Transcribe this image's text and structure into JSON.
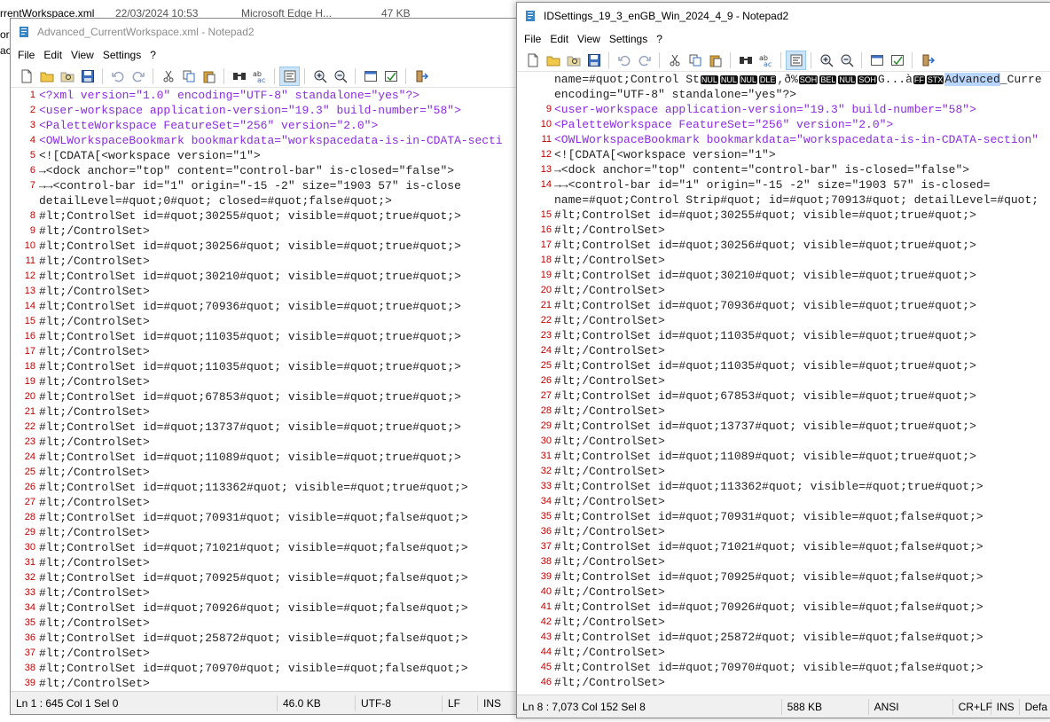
{
  "background": {
    "row_file": "rrentWorkspace.xml",
    "row_date": "22/03/2024 10:53",
    "row_type": "Microsoft Edge H...",
    "row_size": "47 KB",
    "side_text": [
      "ork",
      "ac"
    ]
  },
  "left_window": {
    "title": "Advanced_CurrentWorkspace.xml - Notepad2",
    "menu": [
      "File",
      "Edit",
      "View",
      "Settings",
      "?"
    ],
    "lines": [
      {
        "n": "1",
        "t": "<?xml version=\"1.0\" encoding=\"UTF-8\" standalone=\"yes\"?>"
      },
      {
        "n": "2",
        "t": "<user-workspace application-version=\"19.3\" build-number=\"58\">"
      },
      {
        "n": "3",
        "t": "<PaletteWorkspace FeatureSet=\"256\" version=\"2.0\">"
      },
      {
        "n": "4",
        "t": "<OWLWorkspaceBookmark bookmarkdata=\"workspacedata-is-in-CDATA-secti"
      },
      {
        "n": "5",
        "t": "<![CDATA[<workspace version=\"1\">"
      },
      {
        "n": "6",
        "t": "→<dock anchor=\"top\" content=\"control-bar\" is-closed=\"false\">"
      },
      {
        "n": "7",
        "t": "→→<control-bar id=\"1\" origin=\"-15 -2\" size=\"1903 57\" is-close"
      },
      {
        "n": "",
        "t": "detailLevel=#quot;0#quot; closed=#quot;false#quot;>"
      },
      {
        "n": "8",
        "t": "#lt;ControlSet id=#quot;30255#quot; visible=#quot;true#quot;>"
      },
      {
        "n": "9",
        "t": "#lt;/ControlSet>"
      },
      {
        "n": "10",
        "t": "#lt;ControlSet id=#quot;30256#quot; visible=#quot;true#quot;>"
      },
      {
        "n": "11",
        "t": "#lt;/ControlSet>"
      },
      {
        "n": "12",
        "t": "#lt;ControlSet id=#quot;30210#quot; visible=#quot;true#quot;>"
      },
      {
        "n": "13",
        "t": "#lt;/ControlSet>"
      },
      {
        "n": "14",
        "t": "#lt;ControlSet id=#quot;70936#quot; visible=#quot;true#quot;>"
      },
      {
        "n": "15",
        "t": "#lt;/ControlSet>"
      },
      {
        "n": "16",
        "t": "#lt;ControlSet id=#quot;11035#quot; visible=#quot;true#quot;>"
      },
      {
        "n": "17",
        "t": "#lt;/ControlSet>"
      },
      {
        "n": "18",
        "t": "#lt;ControlSet id=#quot;11035#quot; visible=#quot;true#quot;>"
      },
      {
        "n": "19",
        "t": "#lt;/ControlSet>"
      },
      {
        "n": "20",
        "t": "#lt;ControlSet id=#quot;67853#quot; visible=#quot;true#quot;>"
      },
      {
        "n": "21",
        "t": "#lt;/ControlSet>"
      },
      {
        "n": "22",
        "t": "#lt;ControlSet id=#quot;13737#quot; visible=#quot;true#quot;>"
      },
      {
        "n": "23",
        "t": "#lt;/ControlSet>"
      },
      {
        "n": "24",
        "t": "#lt;ControlSet id=#quot;11089#quot; visible=#quot;true#quot;>"
      },
      {
        "n": "25",
        "t": "#lt;/ControlSet>"
      },
      {
        "n": "26",
        "t": "#lt;ControlSet id=#quot;113362#quot; visible=#quot;true#quot;>"
      },
      {
        "n": "27",
        "t": "#lt;/ControlSet>"
      },
      {
        "n": "28",
        "t": "#lt;ControlSet id=#quot;70931#quot; visible=#quot;false#quot;>"
      },
      {
        "n": "29",
        "t": "#lt;/ControlSet>"
      },
      {
        "n": "30",
        "t": "#lt;ControlSet id=#quot;71021#quot; visible=#quot;false#quot;>"
      },
      {
        "n": "31",
        "t": "#lt;/ControlSet>"
      },
      {
        "n": "32",
        "t": "#lt;ControlSet id=#quot;70925#quot; visible=#quot;false#quot;>"
      },
      {
        "n": "33",
        "t": "#lt;/ControlSet>"
      },
      {
        "n": "34",
        "t": "#lt;ControlSet id=#quot;70926#quot; visible=#quot;false#quot;>"
      },
      {
        "n": "35",
        "t": "#lt;/ControlSet>"
      },
      {
        "n": "36",
        "t": "#lt;ControlSet id=#quot;25872#quot; visible=#quot;false#quot;>"
      },
      {
        "n": "37",
        "t": "#lt;/ControlSet>"
      },
      {
        "n": "38",
        "t": "#lt;ControlSet id=#quot;70970#quot; visible=#quot;false#quot;>"
      },
      {
        "n": "39",
        "t": "#lt;/ControlSet>"
      }
    ],
    "status": {
      "position": "Ln 1 : 645  Col 1  Sel 0",
      "size": "46.0 KB",
      "encoding": "UTF-8",
      "eol": "LF",
      "mode": "INS"
    }
  },
  "right_window": {
    "title": "IDSettings_19_3_enGB_Win_2024_4_9 - Notepad2",
    "menu": [
      "File",
      "Edit",
      "View",
      "Settings",
      "?"
    ],
    "first_line": {
      "pre": "name=#quot;Control St",
      "ctl1": [
        "NUL",
        "NUL",
        "NUL",
        "DLE"
      ],
      "mid1": ",ð%",
      "ctl2": [
        "SOH",
        "BEL",
        "NUL",
        "SOH"
      ],
      "mid2": "G...à",
      "ctl3": [
        "FF",
        "STX"
      ],
      "sel": "Advanced",
      "post": "_Curre"
    },
    "lines": [
      {
        "n": "",
        "t": "encoding=\"UTF-8\" standalone=\"yes\"?>"
      },
      {
        "n": "9",
        "t": "<user-workspace application-version=\"19.3\" build-number=\"58\">"
      },
      {
        "n": "10",
        "t": "<PaletteWorkspace FeatureSet=\"256\" version=\"2.0\">"
      },
      {
        "n": "11",
        "t": "<OWLWorkspaceBookmark bookmarkdata=\"workspacedata-is-in-CDATA-section\""
      },
      {
        "n": "12",
        "t": "<![CDATA[<workspace version=\"1\">"
      },
      {
        "n": "13",
        "t": "→<dock anchor=\"top\" content=\"control-bar\" is-closed=\"false\">"
      },
      {
        "n": "14",
        "t": "→→<control-bar id=\"1\" origin=\"-15 -2\" size=\"1903 57\" is-closed="
      },
      {
        "n": "",
        "t": "name=#quot;Control Strip#quot; id=#quot;70913#quot; detailLevel=#quot;"
      },
      {
        "n": "15",
        "t": "#lt;ControlSet id=#quot;30255#quot; visible=#quot;true#quot;>"
      },
      {
        "n": "16",
        "t": "#lt;/ControlSet>"
      },
      {
        "n": "17",
        "t": "#lt;ControlSet id=#quot;30256#quot; visible=#quot;true#quot;>"
      },
      {
        "n": "18",
        "t": "#lt;/ControlSet>"
      },
      {
        "n": "19",
        "t": "#lt;ControlSet id=#quot;30210#quot; visible=#quot;true#quot;>"
      },
      {
        "n": "20",
        "t": "#lt;/ControlSet>"
      },
      {
        "n": "21",
        "t": "#lt;ControlSet id=#quot;70936#quot; visible=#quot;true#quot;>"
      },
      {
        "n": "22",
        "t": "#lt;/ControlSet>"
      },
      {
        "n": "23",
        "t": "#lt;ControlSet id=#quot;11035#quot; visible=#quot;true#quot;>"
      },
      {
        "n": "24",
        "t": "#lt;/ControlSet>"
      },
      {
        "n": "25",
        "t": "#lt;ControlSet id=#quot;11035#quot; visible=#quot;true#quot;>"
      },
      {
        "n": "26",
        "t": "#lt;/ControlSet>"
      },
      {
        "n": "27",
        "t": "#lt;ControlSet id=#quot;67853#quot; visible=#quot;true#quot;>"
      },
      {
        "n": "28",
        "t": "#lt;/ControlSet>"
      },
      {
        "n": "29",
        "t": "#lt;ControlSet id=#quot;13737#quot; visible=#quot;true#quot;>"
      },
      {
        "n": "30",
        "t": "#lt;/ControlSet>"
      },
      {
        "n": "31",
        "t": "#lt;ControlSet id=#quot;11089#quot; visible=#quot;true#quot;>"
      },
      {
        "n": "32",
        "t": "#lt;/ControlSet>"
      },
      {
        "n": "33",
        "t": "#lt;ControlSet id=#quot;113362#quot; visible=#quot;true#quot;>"
      },
      {
        "n": "34",
        "t": "#lt;/ControlSet>"
      },
      {
        "n": "35",
        "t": "#lt;ControlSet id=#quot;70931#quot; visible=#quot;false#quot;>"
      },
      {
        "n": "36",
        "t": "#lt;/ControlSet>"
      },
      {
        "n": "37",
        "t": "#lt;ControlSet id=#quot;71021#quot; visible=#quot;false#quot;>"
      },
      {
        "n": "38",
        "t": "#lt;/ControlSet>"
      },
      {
        "n": "39",
        "t": "#lt;ControlSet id=#quot;70925#quot; visible=#quot;false#quot;>"
      },
      {
        "n": "40",
        "t": "#lt;/ControlSet>"
      },
      {
        "n": "41",
        "t": "#lt;ControlSet id=#quot;70926#quot; visible=#quot;false#quot;>"
      },
      {
        "n": "42",
        "t": "#lt;/ControlSet>"
      },
      {
        "n": "43",
        "t": "#lt;ControlSet id=#quot;25872#quot; visible=#quot;false#quot;>"
      },
      {
        "n": "44",
        "t": "#lt;/ControlSet>"
      },
      {
        "n": "45",
        "t": "#lt;ControlSet id=#quot;70970#quot; visible=#quot;false#quot;>"
      },
      {
        "n": "46",
        "t": "#lt;/ControlSet>"
      }
    ],
    "status": {
      "position": "Ln 8 : 7,073  Col 152  Sel 8",
      "size": "588 KB",
      "encoding": "ANSI",
      "eol": "CR+LF",
      "mode": "INS",
      "scheme": "Defa"
    }
  },
  "toolbar_icons": [
    "new-file-icon",
    "open-folder-icon",
    "browse-icon",
    "save-icon",
    "undo-icon",
    "redo-icon",
    "cut-icon",
    "copy-icon",
    "paste-icon",
    "find-icon",
    "replace-icon",
    "word-wrap-icon",
    "zoom-in-icon",
    "zoom-out-icon",
    "scheme-icon",
    "customize-icon",
    "exit-icon"
  ],
  "colors": {
    "line_number": "#c00000",
    "xml_tag": "#8a2be2",
    "xml_tag_alt": "#0000cc",
    "selection": "#b8d6ff",
    "active_button": "#cce4f7"
  }
}
